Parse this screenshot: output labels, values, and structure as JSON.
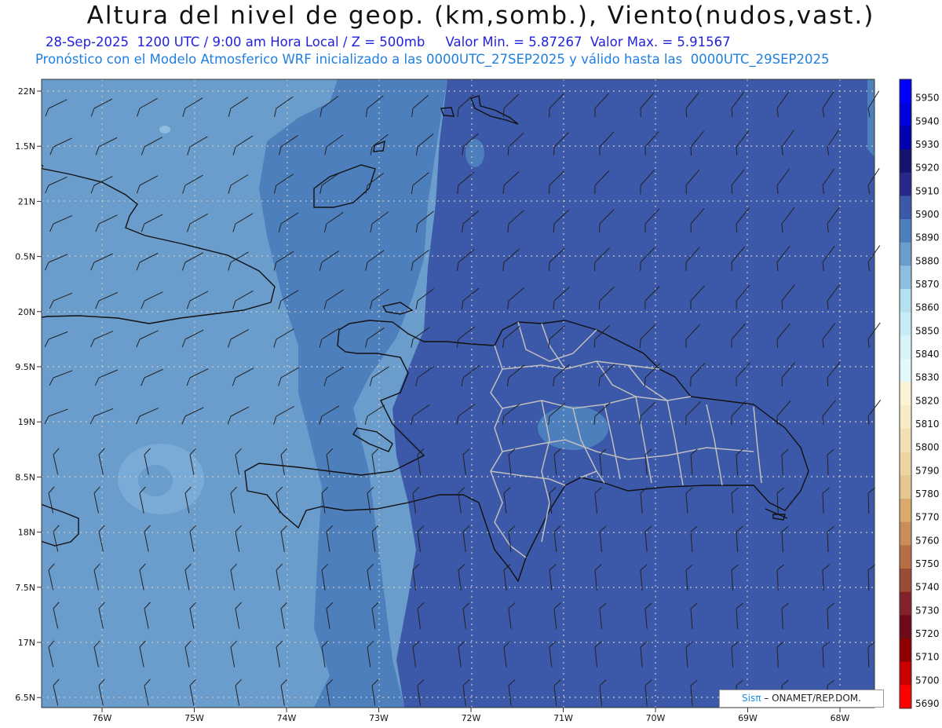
{
  "title": "Altura del nivel de geop. (km,somb.), Viento(nudos,vast.)",
  "subtitle_line1": "28-Sep-2025  1200 UTC / 9:00 am Hora Local / Z = 500mb     Valor Min. = 5.87267  Valor Max. = 5.91567",
  "subtitle_line2": "Pronóstico con el Modelo Atmosferico WRF inicializado a las 0000UTC_27SEP2025 y válido hasta las  0000UTC_29SEP2025",
  "lat_labels": [
    "22N",
    "1.5N",
    "21N",
    "0.5N",
    "20N",
    "9.5N",
    "19N",
    "8.5N",
    "18N",
    "7.5N",
    "17N",
    "6.5N"
  ],
  "lon_labels": [
    "76W",
    "75W",
    "74W",
    "73W",
    "72W",
    "71W",
    "70W",
    "69W",
    "68W"
  ],
  "colorbar_labels": [
    "5950",
    "5940",
    "5930",
    "5920",
    "5910",
    "5900",
    "5890",
    "5880",
    "5870",
    "5860",
    "5850",
    "5840",
    "5830",
    "5820",
    "5810",
    "5800",
    "5790",
    "5780",
    "5770",
    "5760",
    "5750",
    "5740",
    "5730",
    "5720",
    "5710",
    "5700",
    "5690"
  ],
  "colorbar_colors": [
    "#0000ff",
    "#0000dd",
    "#0000b0",
    "#14146e",
    "#28288a",
    "#3c58a8",
    "#4e7fbd",
    "#6b9dcc",
    "#8ebde0",
    "#b5e0f0",
    "#c8ecf5",
    "#d8f3f8",
    "#e2f8fb",
    "#fbf3d4",
    "#f6ebc6",
    "#f2e0b4",
    "#ecd5a2",
    "#e5c690",
    "#d9aa6e",
    "#c98e58",
    "#b56e45",
    "#9a4b36",
    "#84222c",
    "#6e0a1a",
    "#900000",
    "#c80000",
    "#ff0000"
  ],
  "map_colors": {
    "shade_5880": "#6b9dcc",
    "shade_5890": "#4e7fbd",
    "shade_5900": "#3c58a8",
    "coast": "#111111",
    "provinces": "#c0c0c0",
    "grid": "#bbbbbb"
  },
  "credit": {
    "brand": "Sisπ",
    "text": " – ONAMET/REP.DOM."
  }
}
